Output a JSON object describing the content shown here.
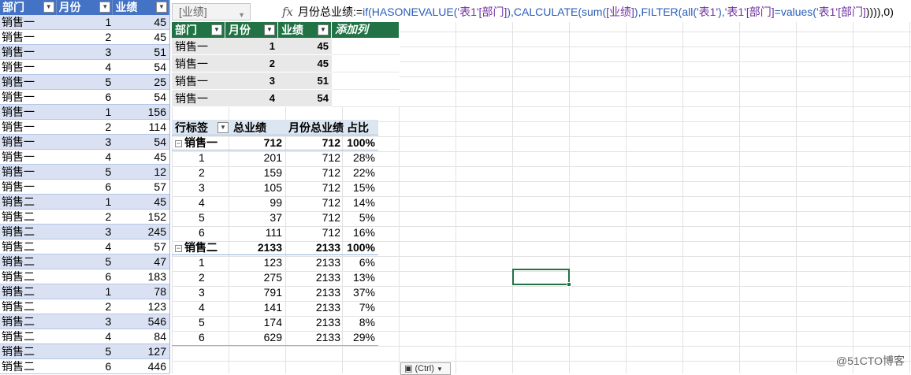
{
  "left_table": {
    "headers": [
      "部门",
      "月份",
      "业绩"
    ],
    "rows": [
      [
        "销售一",
        "1",
        "45"
      ],
      [
        "销售一",
        "2",
        "45"
      ],
      [
        "销售一",
        "3",
        "51"
      ],
      [
        "销售一",
        "4",
        "54"
      ],
      [
        "销售一",
        "5",
        "25"
      ],
      [
        "销售一",
        "6",
        "54"
      ],
      [
        "销售一",
        "1",
        "156"
      ],
      [
        "销售一",
        "2",
        "114"
      ],
      [
        "销售一",
        "3",
        "54"
      ],
      [
        "销售一",
        "4",
        "45"
      ],
      [
        "销售一",
        "5",
        "12"
      ],
      [
        "销售一",
        "6",
        "57"
      ],
      [
        "销售二",
        "1",
        "45"
      ],
      [
        "销售二",
        "2",
        "152"
      ],
      [
        "销售二",
        "3",
        "245"
      ],
      [
        "销售二",
        "4",
        "57"
      ],
      [
        "销售二",
        "5",
        "47"
      ],
      [
        "销售二",
        "6",
        "183"
      ],
      [
        "销售二",
        "1",
        "78"
      ],
      [
        "销售二",
        "2",
        "123"
      ],
      [
        "销售二",
        "3",
        "546"
      ],
      [
        "销售二",
        "4",
        "84"
      ],
      [
        "销售二",
        "5",
        "127"
      ],
      [
        "销售二",
        "6",
        "446"
      ]
    ]
  },
  "formula_bar": {
    "name_box": "[业绩]",
    "fx": "fx",
    "formula_parts": [
      {
        "t": "月份总业绩:=",
        "c": "plain"
      },
      {
        "t": "if(",
        "c": "blue"
      },
      {
        "t": "HASONEVALUE(",
        "c": "blue"
      },
      {
        "t": "'表1'[部门]",
        "c": "purple"
      },
      {
        "t": "),",
        "c": "blue"
      },
      {
        "t": "CALCULATE(",
        "c": "blue"
      },
      {
        "t": "sum(",
        "c": "blue"
      },
      {
        "t": "[业绩]",
        "c": "purple"
      },
      {
        "t": "),",
        "c": "blue"
      },
      {
        "t": "FILTER(",
        "c": "blue"
      },
      {
        "t": "all(",
        "c": "blue"
      },
      {
        "t": "'表1'",
        "c": "purple"
      },
      {
        "t": "),",
        "c": "blue"
      },
      {
        "t": "'表1'[部门]",
        "c": "purple"
      },
      {
        "t": "=",
        "c": "blue"
      },
      {
        "t": "values(",
        "c": "blue"
      },
      {
        "t": "'表1'[部门]",
        "c": "purple"
      },
      {
        "t": ")))),0)",
        "c": "plain"
      }
    ]
  },
  "top_table": {
    "headers": [
      "部门",
      "月份",
      "业绩",
      "添加列"
    ],
    "rows": [
      [
        "销售一",
        "1",
        "45"
      ],
      [
        "销售一",
        "2",
        "45"
      ],
      [
        "销售一",
        "3",
        "51"
      ],
      [
        "销售一",
        "4",
        "54"
      ]
    ]
  },
  "pivot": {
    "headers": [
      "行标签",
      "总业绩",
      "月份总业绩",
      "占比"
    ],
    "groups": [
      {
        "label": "销售一",
        "total": "712",
        "month_total": "712",
        "ratio": "100%",
        "children": [
          [
            "1",
            "201",
            "712",
            "28%"
          ],
          [
            "2",
            "159",
            "712",
            "22%"
          ],
          [
            "3",
            "105",
            "712",
            "15%"
          ],
          [
            "4",
            "99",
            "712",
            "14%"
          ],
          [
            "5",
            "37",
            "712",
            "5%"
          ],
          [
            "6",
            "111",
            "712",
            "16%"
          ]
        ]
      },
      {
        "label": "销售二",
        "total": "2133",
        "month_total": "2133",
        "ratio": "100%",
        "children": [
          [
            "1",
            "123",
            "2133",
            "6%"
          ],
          [
            "2",
            "275",
            "2133",
            "13%"
          ],
          [
            "3",
            "791",
            "2133",
            "37%"
          ],
          [
            "4",
            "141",
            "2133",
            "7%"
          ],
          [
            "5",
            "174",
            "2133",
            "8%"
          ],
          [
            "6",
            "629",
            "2133",
            "29%"
          ]
        ]
      }
    ]
  },
  "paste_options": "(Ctrl)",
  "watermark": "@51CTO博客",
  "icons": {
    "dropdown": "triangle-down",
    "collapse": "minus-box",
    "paste": "clipboard"
  }
}
